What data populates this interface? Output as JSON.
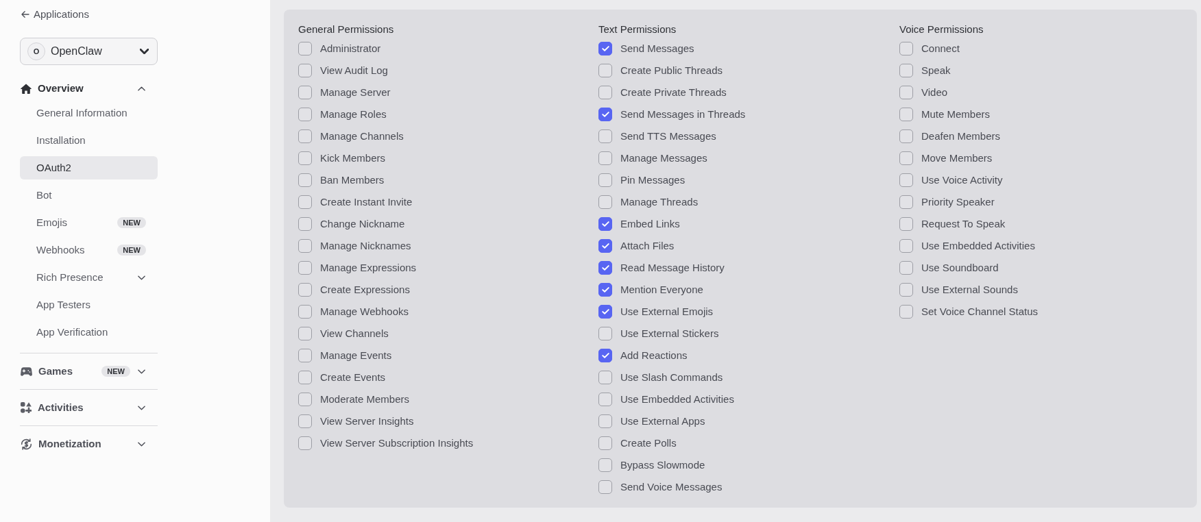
{
  "sidebar": {
    "back_link": "Applications",
    "app_selector": {
      "avatar": "O",
      "name": "OpenClaw"
    },
    "sections": [
      {
        "label": "Overview",
        "expanded": true,
        "items": [
          {
            "label": "General Information",
            "kind": "link",
            "selected": false
          },
          {
            "label": "Installation",
            "kind": "link",
            "selected": false
          },
          {
            "label": "OAuth2",
            "kind": "link",
            "selected": true
          },
          {
            "label": "Bot",
            "kind": "link",
            "selected": false
          },
          {
            "label": "Emojis",
            "kind": "link",
            "selected": false,
            "badge": "NEW"
          },
          {
            "label": "Webhooks",
            "kind": "link",
            "selected": false,
            "badge": "NEW"
          },
          {
            "label": "Rich Presence",
            "kind": "group",
            "selected": false,
            "expanded": false
          },
          {
            "label": "App Testers",
            "kind": "link",
            "selected": false
          },
          {
            "label": "App Verification",
            "kind": "link",
            "selected": false
          }
        ]
      },
      {
        "label": "Games",
        "expanded": false,
        "badge": "NEW"
      },
      {
        "label": "Activities",
        "expanded": false
      },
      {
        "label": "Monetization",
        "expanded": false
      }
    ]
  },
  "permission_groups": [
    {
      "title": "General Permissions",
      "permissions": [
        {
          "label": "Administrator",
          "checked": false
        },
        {
          "label": "View Audit Log",
          "checked": false
        },
        {
          "label": "Manage Server",
          "checked": false
        },
        {
          "label": "Manage Roles",
          "checked": false
        },
        {
          "label": "Manage Channels",
          "checked": false
        },
        {
          "label": "Kick Members",
          "checked": false
        },
        {
          "label": "Ban Members",
          "checked": false
        },
        {
          "label": "Create Instant Invite",
          "checked": false
        },
        {
          "label": "Change Nickname",
          "checked": false
        },
        {
          "label": "Manage Nicknames",
          "checked": false
        },
        {
          "label": "Manage Expressions",
          "checked": false
        },
        {
          "label": "Create Expressions",
          "checked": false
        },
        {
          "label": "Manage Webhooks",
          "checked": false
        },
        {
          "label": "View Channels",
          "checked": false
        },
        {
          "label": "Manage Events",
          "checked": false
        },
        {
          "label": "Create Events",
          "checked": false
        },
        {
          "label": "Moderate Members",
          "checked": false
        },
        {
          "label": "View Server Insights",
          "checked": false
        },
        {
          "label": "View Server Subscription Insights",
          "checked": false
        }
      ]
    },
    {
      "title": "Text Permissions",
      "permissions": [
        {
          "label": "Send Messages",
          "checked": true
        },
        {
          "label": "Create Public Threads",
          "checked": false
        },
        {
          "label": "Create Private Threads",
          "checked": false
        },
        {
          "label": "Send Messages in Threads",
          "checked": true
        },
        {
          "label": "Send TTS Messages",
          "checked": false
        },
        {
          "label": "Manage Messages",
          "checked": false
        },
        {
          "label": "Pin Messages",
          "checked": false
        },
        {
          "label": "Manage Threads",
          "checked": false
        },
        {
          "label": "Embed Links",
          "checked": true
        },
        {
          "label": "Attach Files",
          "checked": true
        },
        {
          "label": "Read Message History",
          "checked": true
        },
        {
          "label": "Mention Everyone",
          "checked": true
        },
        {
          "label": "Use External Emojis",
          "checked": true
        },
        {
          "label": "Use External Stickers",
          "checked": false
        },
        {
          "label": "Add Reactions",
          "checked": true
        },
        {
          "label": "Use Slash Commands",
          "checked": false
        },
        {
          "label": "Use Embedded Activities",
          "checked": false
        },
        {
          "label": "Use External Apps",
          "checked": false
        },
        {
          "label": "Create Polls",
          "checked": false
        },
        {
          "label": "Bypass Slowmode",
          "checked": false
        },
        {
          "label": "Send Voice Messages",
          "checked": false
        }
      ]
    },
    {
      "title": "Voice Permissions",
      "permissions": [
        {
          "label": "Connect",
          "checked": false
        },
        {
          "label": "Speak",
          "checked": false
        },
        {
          "label": "Video",
          "checked": false
        },
        {
          "label": "Mute Members",
          "checked": false
        },
        {
          "label": "Deafen Members",
          "checked": false
        },
        {
          "label": "Move Members",
          "checked": false
        },
        {
          "label": "Use Voice Activity",
          "checked": false
        },
        {
          "label": "Priority Speaker",
          "checked": false
        },
        {
          "label": "Request To Speak",
          "checked": false
        },
        {
          "label": "Use Embedded Activities",
          "checked": false
        },
        {
          "label": "Use Soundboard",
          "checked": false
        },
        {
          "label": "Use External Sounds",
          "checked": false
        },
        {
          "label": "Set Voice Channel Status",
          "checked": false
        }
      ]
    }
  ]
}
